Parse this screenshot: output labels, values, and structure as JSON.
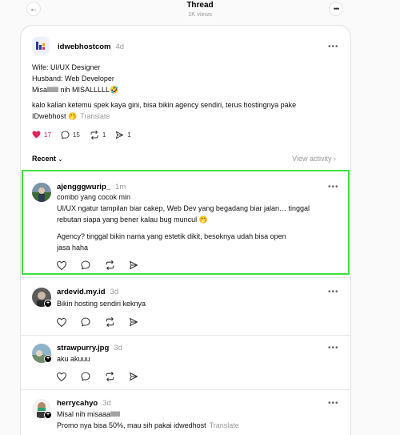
{
  "header": {
    "title": "Thread",
    "views": "1K views"
  },
  "post": {
    "username": "idwebhostcom",
    "time": "4d",
    "lines": [
      "Wife: UI/UX Designer",
      "Husband: Web Developer",
      "Misalllllll nih MISALLLLL🤣"
    ],
    "body_line1": "kalo kalian ketemu spek kaya gini, bisa bikin agency sendiri, terus hostingnya pake",
    "body_line2": "IDwebhost 🤭",
    "translate": "Translate",
    "likes": "17",
    "replies": "15",
    "reposts": "1",
    "shares": "1"
  },
  "recent": {
    "label": "Recent",
    "view_activity": "View activity"
  },
  "replies": [
    {
      "username": "ajengggwurip_",
      "time": "1m",
      "lines": [
        "combo yang cocok min",
        "UI/UX ngatur tampilan biar cakep, Web Dev yang begadang biar jalan… tinggal",
        "rebutan siapa yang bener kalau bug muncul 🤭",
        "Agency? tinggal bikin nama yang estetik dikit, besoknya udah bisa open",
        "jasa haha"
      ]
    },
    {
      "username": "ardevid.my.id",
      "time": "3d",
      "lines": [
        "Bikin hosting sendiri keknya"
      ]
    },
    {
      "username": "strawpurry.jpg",
      "time": "3d",
      "lines": [
        "aku akuuu"
      ]
    },
    {
      "username": "herrycahyo",
      "time": "3d",
      "lines": [
        "Misal nih misaaallllll",
        "Promo nya bisa 50%, mau sih pakai idwedhost"
      ],
      "translate": "Translate"
    }
  ],
  "colors": {
    "like": "#e0245e",
    "highlight": "#3ee23e"
  }
}
